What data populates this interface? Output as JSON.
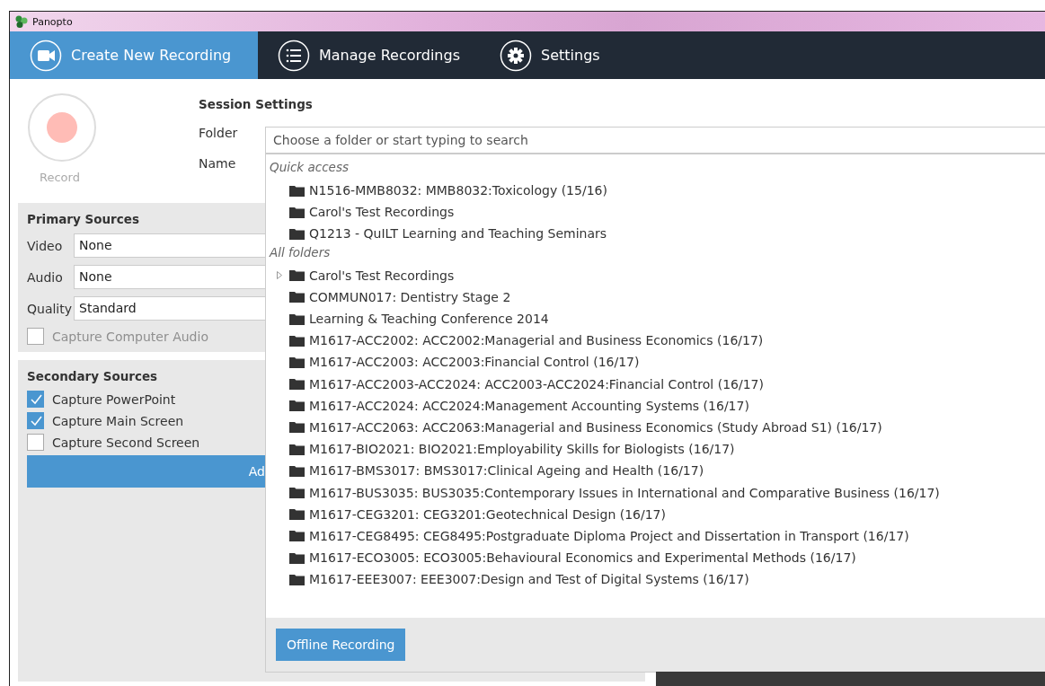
{
  "window": {
    "title": "Panopto"
  },
  "nav_tabs": [
    {
      "label": "Create New Recording",
      "selected": true
    },
    {
      "label": "Manage Recordings",
      "selected": false
    },
    {
      "label": "Settings",
      "selected": false
    }
  ],
  "record": {
    "label": "Record",
    "disabled": true
  },
  "session_settings": {
    "title": "Session Settings",
    "folder_label": "Folder",
    "name_label": "Name"
  },
  "primary_sources": {
    "title": "Primary Sources",
    "fields": [
      {
        "label": "Video",
        "value": "None"
      },
      {
        "label": "Audio",
        "value": "None"
      },
      {
        "label": "Quality",
        "value": "Standard"
      }
    ],
    "capture_computer_audio": {
      "label": "Capture Computer Audio",
      "checked": false,
      "disabled": true
    }
  },
  "secondary_sources": {
    "title": "Secondary Sources",
    "options": [
      {
        "label": "Capture PowerPoint",
        "checked": true
      },
      {
        "label": "Capture Main Screen",
        "checked": true
      },
      {
        "label": "Capture Second Screen",
        "checked": false
      }
    ],
    "button": "Ad"
  },
  "folder_dropdown": {
    "placeholder": "Choose a folder or start typing to search",
    "sections": [
      {
        "title": "Quick access",
        "items": [
          {
            "name": "N1516-MMB8032: MMB8032:Toxicology (15/16)",
            "expandable": false
          },
          {
            "name": "Carol's Test Recordings",
            "expandable": false
          },
          {
            "name": "Q1213 - QuILT Learning and Teaching Seminars",
            "expandable": false
          }
        ]
      },
      {
        "title": "All folders",
        "items": [
          {
            "name": "Carol's Test Recordings",
            "expandable": true
          },
          {
            "name": "COMMUN017: Dentistry Stage 2",
            "expandable": false
          },
          {
            "name": "Learning & Teaching Conference 2014",
            "expandable": false
          },
          {
            "name": "M1617-ACC2002: ACC2002:Managerial and Business Economics (16/17)",
            "expandable": false
          },
          {
            "name": "M1617-ACC2003: ACC2003:Financial Control (16/17)",
            "expandable": false
          },
          {
            "name": "M1617-ACC2003-ACC2024: ACC2003-ACC2024:Financial Control (16/17)",
            "expandable": false
          },
          {
            "name": "M1617-ACC2024: ACC2024:Management Accounting Systems (16/17)",
            "expandable": false
          },
          {
            "name": "M1617-ACC2063: ACC2063:Managerial and Business Economics (Study Abroad S1) (16/17)",
            "expandable": false
          },
          {
            "name": "M1617-BIO2021: BIO2021:Employability Skills for Biologists (16/17)",
            "expandable": false
          },
          {
            "name": "M1617-BMS3017: BMS3017:Clinical Ageing and Health (16/17)",
            "expandable": false
          },
          {
            "name": "M1617-BUS3035: BUS3035:Contemporary Issues in International and Comparative Business (16/17)",
            "expandable": false
          },
          {
            "name": "M1617-CEG3201: CEG3201:Geotechnical Design (16/17)",
            "expandable": false
          },
          {
            "name": "M1617-CEG8495: CEG8495:Postgraduate Diploma Project and Dissertation in Transport (16/17)",
            "expandable": false
          },
          {
            "name": "M1617-ECO3005: ECO3005:Behavioural Economics and Experimental Methods (16/17)",
            "expandable": false
          },
          {
            "name": "M1617-EEE3007: EEE3007:Design and Test of Digital Systems (16/17)",
            "expandable": false
          }
        ]
      }
    ],
    "footer_button": "Offline Recording"
  }
}
